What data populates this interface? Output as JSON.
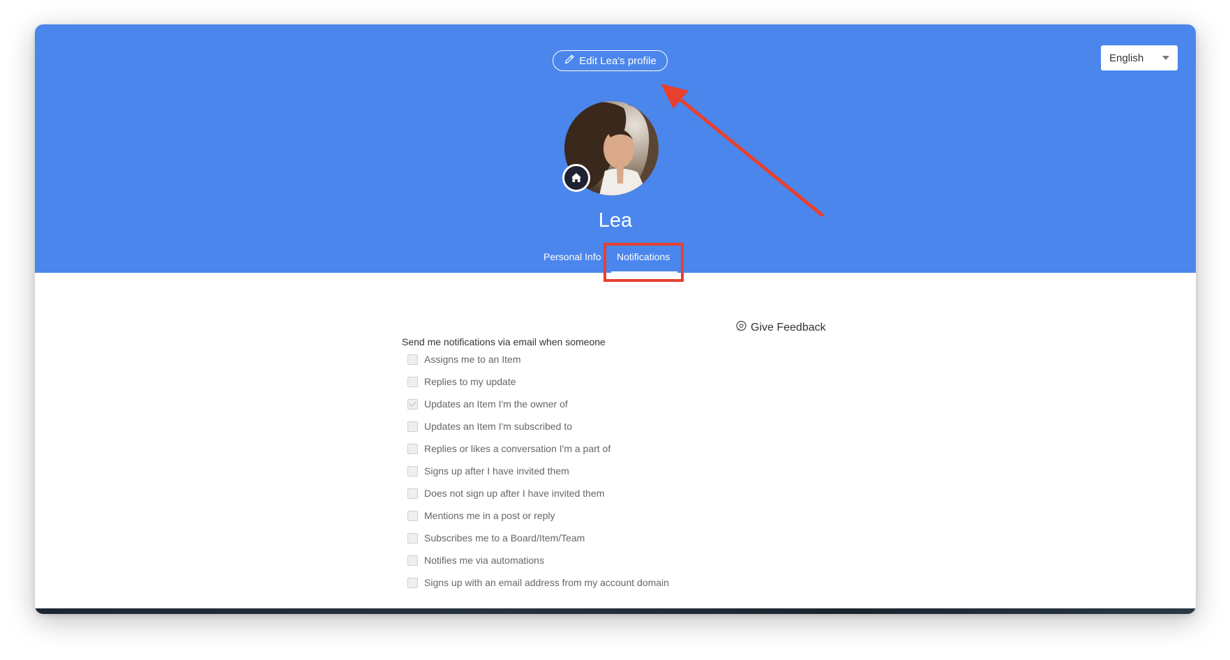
{
  "header": {
    "edit_button_label": "Edit Lea's profile",
    "language": "English",
    "user_name": "Lea",
    "tabs": [
      {
        "label": "Personal Info",
        "active": false
      },
      {
        "label": "Notifications",
        "active": true
      }
    ]
  },
  "feedback_label": "Give Feedback",
  "notifications": {
    "heading": "Send me notifications via email when someone",
    "options": [
      {
        "label": "Assigns me to an Item",
        "checked": false
      },
      {
        "label": "Replies to my update",
        "checked": false
      },
      {
        "label": "Updates an Item I'm the owner of",
        "checked": true
      },
      {
        "label": "Updates an Item I'm subscribed to",
        "checked": false
      },
      {
        "label": "Replies or likes a conversation I'm a part of",
        "checked": false
      },
      {
        "label": "Signs up after I have invited them",
        "checked": false
      },
      {
        "label": "Does not sign up after I have invited them",
        "checked": false
      },
      {
        "label": "Mentions me in a post or reply",
        "checked": false
      },
      {
        "label": "Subscribes me to a Board/Item/Team",
        "checked": false
      },
      {
        "label": "Notifies me via automations",
        "checked": false
      },
      {
        "label": "Signs up with an email address from my account domain",
        "checked": false
      }
    ]
  },
  "colors": {
    "header_bg": "#4a86ec",
    "annotation_red": "#e8402f"
  },
  "icons": [
    "pencil-icon",
    "home-icon",
    "chevron-down-icon",
    "feedback-icon"
  ]
}
